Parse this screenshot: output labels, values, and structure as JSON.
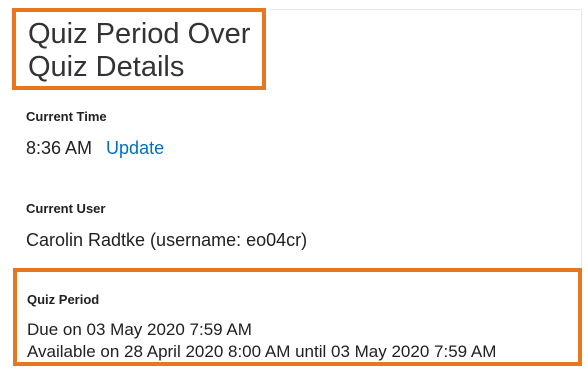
{
  "header": {
    "title": "Quiz Period Over",
    "subtitle": "Quiz Details"
  },
  "current_time": {
    "label": "Current Time",
    "value": "8:36 AM",
    "update_link": "Update"
  },
  "current_user": {
    "label": "Current User",
    "value": "Carolin Radtke (username: eo04cr)"
  },
  "quiz_period": {
    "label": "Quiz Period",
    "due": "Due on 03 May 2020 7:59 AM",
    "available": "Available on 28 April 2020 8:00 AM until 03 May 2020 7:59 AM"
  },
  "colors": {
    "highlight_border": "#e8761e",
    "link": "#006fbf",
    "text": "#202122"
  }
}
